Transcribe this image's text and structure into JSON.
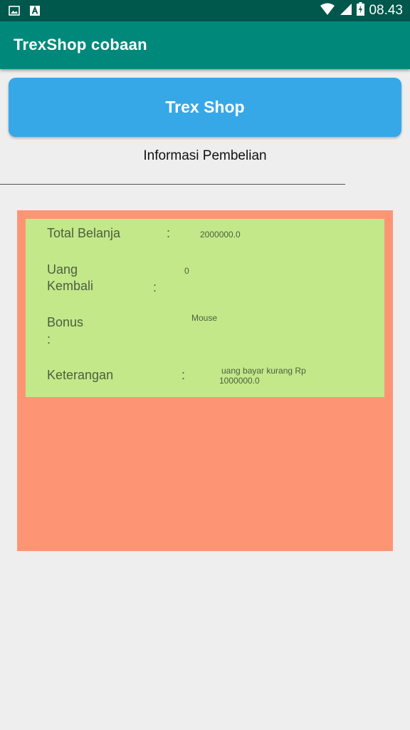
{
  "status_bar": {
    "time": "08.43",
    "icons": [
      "image-icon",
      "font-a-icon",
      "wifi-icon",
      "signal-icon",
      "battery-charging-icon"
    ]
  },
  "app_bar": {
    "title": "TrexShop cobaan",
    "color": "#00897b"
  },
  "shop_button": {
    "label": "Trex Shop",
    "color": "#36a8e8"
  },
  "info": {
    "heading": "Informasi Pembelian"
  },
  "details": {
    "total": {
      "label": "Total Belanja",
      "colon": ":",
      "value": "2000000.0"
    },
    "change": {
      "label_line1": "Uang",
      "label_line2": "Kembali",
      "colon": ":",
      "value": "0"
    },
    "bonus": {
      "label": "Bonus",
      "colon": ":",
      "value": "Mouse"
    },
    "note": {
      "label": "Keterangan",
      "colon": ":",
      "value_line1": "uang bayar kurang Rp",
      "value_line2": "1000000.0"
    }
  },
  "colors": {
    "outer_panel": "#fd9575",
    "inner_panel": "#c2e88a",
    "status_bar": "#00574b"
  }
}
